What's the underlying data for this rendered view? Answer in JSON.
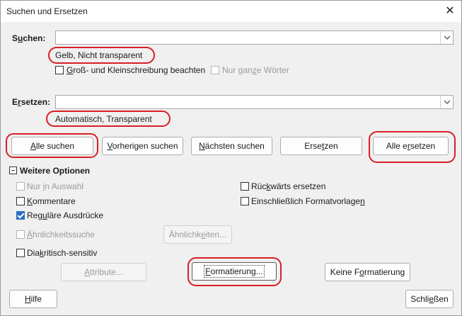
{
  "window": {
    "title": "Suchen und Ersetzen"
  },
  "search": {
    "label_pre": "S",
    "label_u": "u",
    "label_post": "chen:",
    "value": "",
    "attributes": "Gelb, Nicht transparent",
    "match_case_pre": "",
    "match_case_u": "G",
    "match_case_post": "roß- und Kleinschreibung beachten",
    "whole_words_pre": "Nur gan",
    "whole_words_u": "z",
    "whole_words_post": "e Wörter"
  },
  "replace": {
    "label_pre": "E",
    "label_u": "r",
    "label_post": "setzen:",
    "value": "",
    "attributes": "Automatisch, Transparent"
  },
  "buttons": {
    "find_all_pre": "",
    "find_all_u": "A",
    "find_all_post": "lle suchen",
    "find_prev_pre": "",
    "find_prev_u": "V",
    "find_prev_post": "orherigen suchen",
    "find_next_pre": "",
    "find_next_u": "N",
    "find_next_post": "ächsten suchen",
    "replace_pre": "Erse",
    "replace_u": "t",
    "replace_post": "zen",
    "replace_all_pre": "Alle e",
    "replace_all_u": "r",
    "replace_all_post": "setzen"
  },
  "options": {
    "header": "Weitere Optionen",
    "in_selection_pre": "Nur ",
    "in_selection_u": "i",
    "in_selection_post": "n Auswahl",
    "backwards_pre": "Rüc",
    "backwards_u": "k",
    "backwards_post": "wärts ersetzen",
    "comments_pre": "",
    "comments_u": "K",
    "comments_post": "ommentare",
    "styles_pre": "Einschließlich Formatvorlage",
    "styles_u": "n",
    "styles_post": "",
    "regex_pre": "Reg",
    "regex_u": "u",
    "regex_post": "läre Ausdrücke",
    "similarity_pre": "",
    "similarity_u": "Ä",
    "similarity_post": "hnlichkeitssuche",
    "similarity_btn_pre": "Ähnlichk",
    "similarity_btn_u": "e",
    "similarity_btn_post": "iten...",
    "diacritics_pre": "Dia",
    "diacritics_u": "k",
    "diacritics_post": "ritisch-sensitiv",
    "attributes_btn_pre": "",
    "attributes_btn_u": "A",
    "attributes_btn_post": "ttribute...",
    "format_btn_pre": "",
    "format_btn_u": "F",
    "format_btn_post": "ormatierung...",
    "no_format_btn_pre": "Keine F",
    "no_format_btn_u": "o",
    "no_format_btn_post": "rmatierung"
  },
  "footer": {
    "help_pre": "",
    "help_u": "H",
    "help_post": "ilfe",
    "close_pre": "Schli",
    "close_u": "e",
    "close_post": "ßen"
  },
  "colors": {
    "highlight_ring": "#d81f26",
    "checkbox_checked": "#2c6fc2"
  },
  "icons": [
    "close-icon",
    "chevron-down-icon",
    "collapse-minus-icon",
    "checkmark-icon"
  ]
}
